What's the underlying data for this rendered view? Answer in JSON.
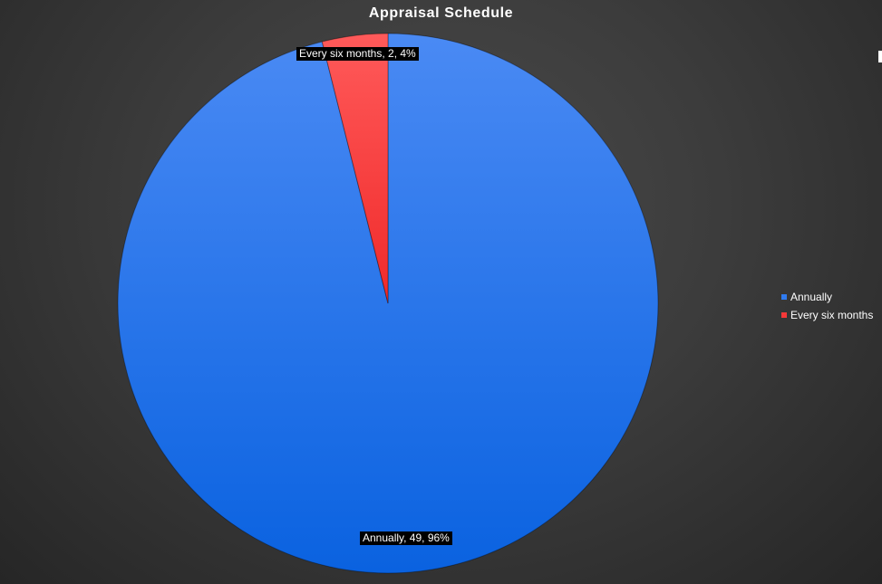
{
  "chart_data": {
    "type": "pie",
    "title": "Appraisal Schedule",
    "slices": [
      {
        "name": "Annually",
        "value": 49,
        "percent": 96,
        "label": "Annually, 49, 96%",
        "color": "#1e6ff2"
      },
      {
        "name": "Every six months",
        "value": 2,
        "percent": 4,
        "label": "Every six months, 2, 4%",
        "color": "#f73838"
      }
    ],
    "legend": {
      "position": "right",
      "items": [
        "Annually",
        "Every six months"
      ]
    },
    "colors": {
      "background": "#3a3a3a",
      "annually": "#1e6ff2",
      "every_six_months": "#f73838"
    }
  }
}
